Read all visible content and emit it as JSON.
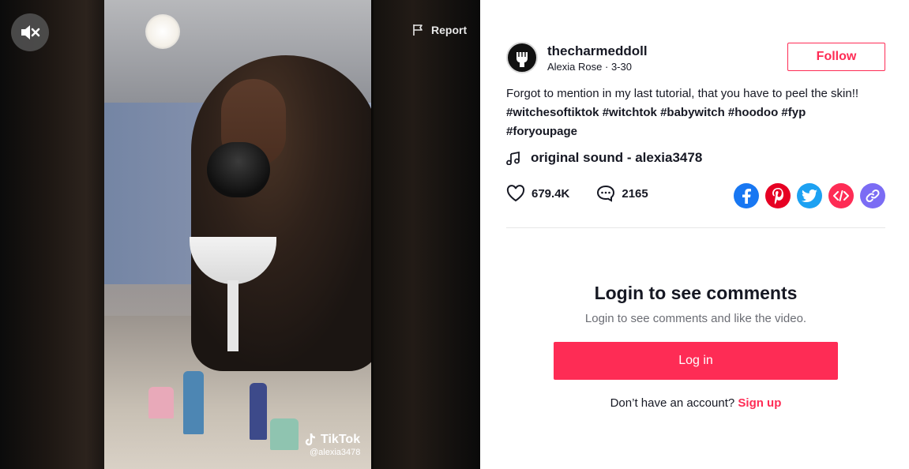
{
  "video": {
    "report_label": "Report",
    "watermark_brand": "TikTok",
    "watermark_handle": "@alexia3478"
  },
  "author": {
    "username": "thecharmeddoll",
    "nickname": "Alexia Rose",
    "date": "3-30",
    "follow_label": "Follow"
  },
  "description": {
    "text": "Forgot to mention in my last tutorial, that you have to peel the skin!!",
    "hashtags": [
      "#witchesoftiktok",
      "#witchtok",
      "#babywitch",
      "#hoodoo",
      "#fyp",
      "#foryoupage"
    ]
  },
  "music": {
    "title": "original sound - alexia3478",
    "icon": "music-note-icon"
  },
  "stats": {
    "likes": "679.4K",
    "comments": "2165"
  },
  "share": {
    "icons": [
      "facebook-icon",
      "pinterest-icon",
      "twitter-icon",
      "embed-icon",
      "link-icon"
    ],
    "colors": {
      "facebook": "#1877f2",
      "pinterest": "#e60023",
      "twitter": "#1da1f2",
      "embed": "#fe2c55",
      "link": "#7b6cf4"
    }
  },
  "comments_login": {
    "title": "Login to see comments",
    "subtitle": "Login to see comments and like the video.",
    "login_button": "Log in",
    "signup_prompt": "Don’t have an account?",
    "signup_link": "Sign up"
  },
  "theme": {
    "accent": "#fe2c55",
    "text_primary": "#161823"
  }
}
